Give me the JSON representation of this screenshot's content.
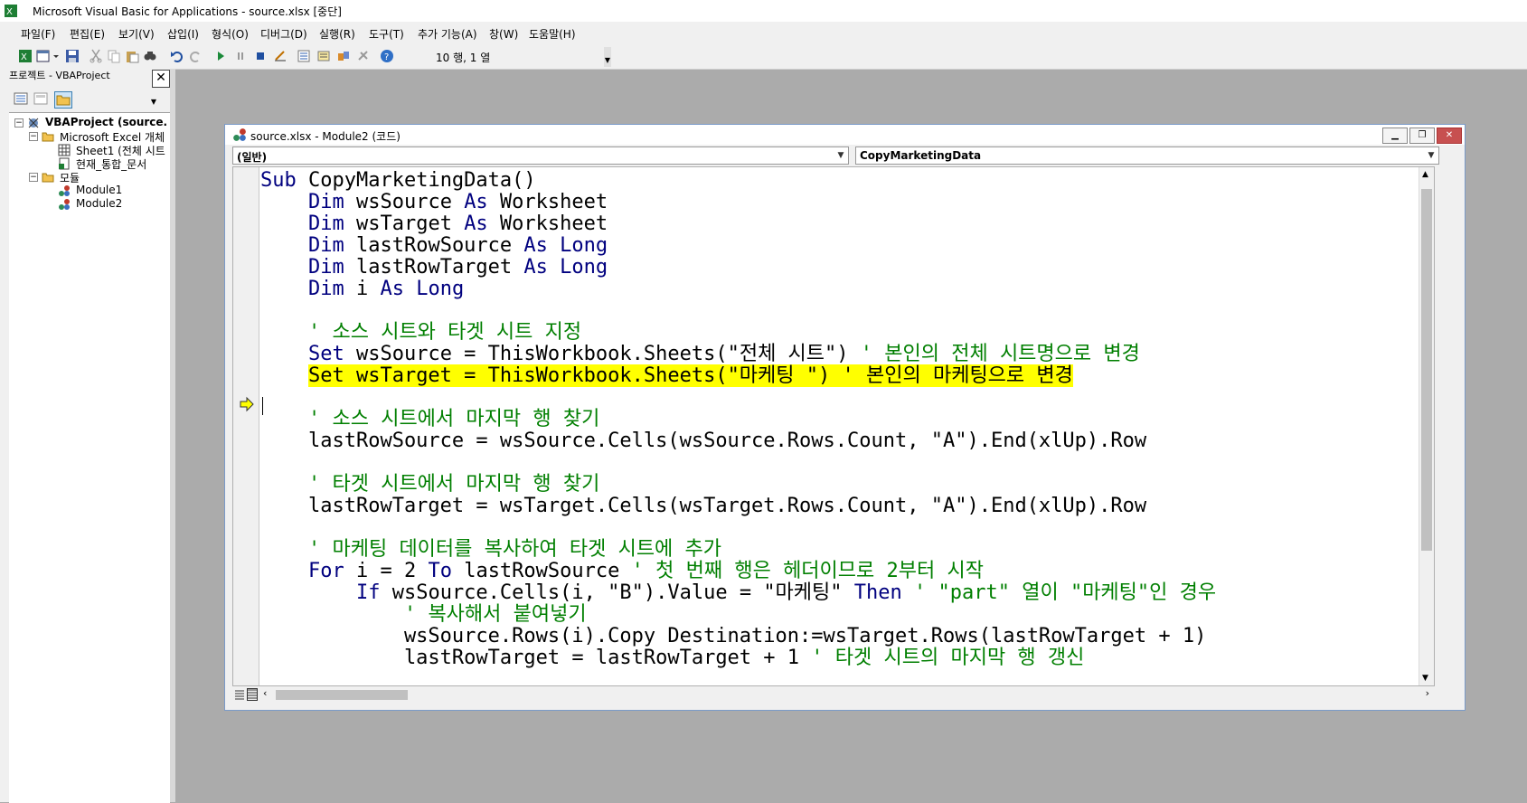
{
  "window": {
    "title": "Microsoft Visual Basic for Applications - source.xlsx [중단]"
  },
  "menu": [
    "파일(F)",
    "편집(E)",
    "보기(V)",
    "삽입(I)",
    "형식(O)",
    "디버그(D)",
    "실행(R)",
    "도구(T)",
    "추가 기능(A)",
    "창(W)",
    "도움말(H)"
  ],
  "toolbar": {
    "position_text": "10 행, 1 열"
  },
  "project_pane": {
    "title": "프로젝트 - VBAProject",
    "tree": {
      "root": "VBAProject (source.",
      "objects_folder": "Microsoft Excel 개체",
      "sheet": "Sheet1 (전체 시트",
      "workbook": "현재_통합_문서",
      "modules_folder": "모듈",
      "module1": "Module1",
      "module2": "Module2"
    }
  },
  "code_window": {
    "title": "source.xlsx - Module2 (코드)",
    "object_combo": "(일반)",
    "proc_combo": "CopyMarketingData"
  },
  "code_lines": [
    [
      [
        "kw",
        "Sub"
      ],
      [
        "tx",
        " CopyMarketingData()"
      ]
    ],
    [
      [
        "tx",
        "    "
      ],
      [
        "kw",
        "Dim"
      ],
      [
        "tx",
        " wsSource "
      ],
      [
        "kw",
        "As"
      ],
      [
        "tx",
        " Worksheet"
      ]
    ],
    [
      [
        "tx",
        "    "
      ],
      [
        "kw",
        "Dim"
      ],
      [
        "tx",
        " wsTarget "
      ],
      [
        "kw",
        "As"
      ],
      [
        "tx",
        " Worksheet"
      ]
    ],
    [
      [
        "tx",
        "    "
      ],
      [
        "kw",
        "Dim"
      ],
      [
        "tx",
        " lastRowSource "
      ],
      [
        "kw",
        "As"
      ],
      [
        "tx",
        " "
      ],
      [
        "kw",
        "Long"
      ]
    ],
    [
      [
        "tx",
        "    "
      ],
      [
        "kw",
        "Dim"
      ],
      [
        "tx",
        " lastRowTarget "
      ],
      [
        "kw",
        "As"
      ],
      [
        "tx",
        " "
      ],
      [
        "kw",
        "Long"
      ]
    ],
    [
      [
        "tx",
        "    "
      ],
      [
        "kw",
        "Dim"
      ],
      [
        "tx",
        " i "
      ],
      [
        "kw",
        "As"
      ],
      [
        "tx",
        " "
      ],
      [
        "kw",
        "Long"
      ]
    ],
    [
      [
        "tx",
        ""
      ]
    ],
    [
      [
        "tx",
        "    "
      ],
      [
        "cm",
        "' 소스 시트와 타겟 시트 지정"
      ]
    ],
    [
      [
        "tx",
        "    "
      ],
      [
        "kw",
        "Set"
      ],
      [
        "tx",
        " wsSource = ThisWorkbook.Sheets(\"전체 시트\") "
      ],
      [
        "cm",
        "' 본인의 전체 시트명으로 변경"
      ]
    ],
    [
      [
        "tx",
        "    "
      ],
      [
        "hl",
        "Set wsTarget = ThisWorkbook.Sheets(\"마케팅 \") ' 본인의 마케팅으로 변경"
      ]
    ],
    [
      [
        "tx",
        ""
      ]
    ],
    [
      [
        "tx",
        "    "
      ],
      [
        "cm",
        "' 소스 시트에서 마지막 행 찾기"
      ]
    ],
    [
      [
        "tx",
        "    lastRowSource = wsSource.Cells(wsSource.Rows.Count, \"A\").End(xlUp).Row"
      ]
    ],
    [
      [
        "tx",
        ""
      ]
    ],
    [
      [
        "tx",
        "    "
      ],
      [
        "cm",
        "' 타겟 시트에서 마지막 행 찾기"
      ]
    ],
    [
      [
        "tx",
        "    lastRowTarget = wsTarget.Cells(wsTarget.Rows.Count, \"A\").End(xlUp).Row"
      ]
    ],
    [
      [
        "tx",
        ""
      ]
    ],
    [
      [
        "tx",
        "    "
      ],
      [
        "cm",
        "' 마케팅 데이터를 복사하여 타겟 시트에 추가"
      ]
    ],
    [
      [
        "tx",
        "    "
      ],
      [
        "kw",
        "For"
      ],
      [
        "tx",
        " i = 2 "
      ],
      [
        "kw",
        "To"
      ],
      [
        "tx",
        " lastRowSource "
      ],
      [
        "cm",
        "' 첫 번째 행은 헤더이므로 2부터 시작"
      ]
    ],
    [
      [
        "tx",
        "        "
      ],
      [
        "kw",
        "If"
      ],
      [
        "tx",
        " wsSource.Cells(i, \"B\").Value = \"마케팅\" "
      ],
      [
        "kw",
        "Then"
      ],
      [
        "tx",
        " "
      ],
      [
        "cm",
        "' \"part\" 열이 \"마케팅\"인 경우"
      ]
    ],
    [
      [
        "tx",
        "            "
      ],
      [
        "cm",
        "' 복사해서 붙여넣기"
      ]
    ],
    [
      [
        "tx",
        "            wsSource.Rows(i).Copy Destination:=wsTarget.Rows(lastRowTarget + 1)"
      ]
    ],
    [
      [
        "tx",
        "            lastRowTarget = lastRowTarget + 1 "
      ],
      [
        "cm",
        "' 타겟 시트의 마지막 행 갱신"
      ]
    ]
  ],
  "colors": {
    "keyword": "#00007f",
    "comment": "#007f00",
    "highlight": "#ffff00"
  }
}
